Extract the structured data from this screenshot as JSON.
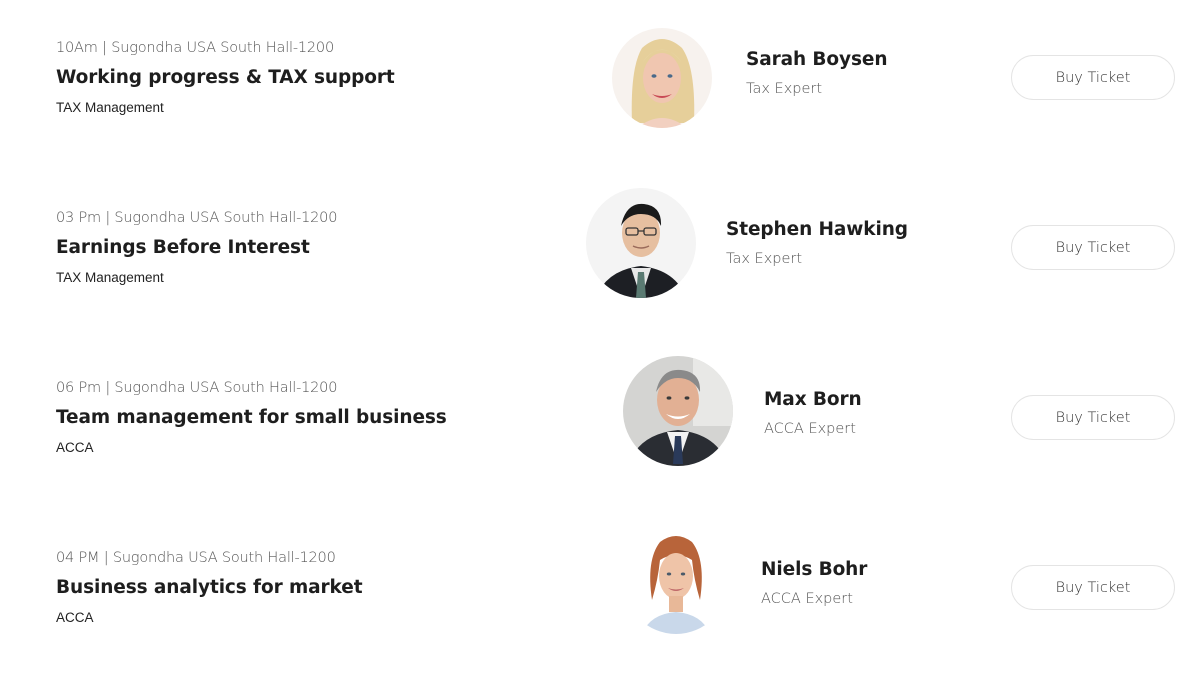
{
  "sessions": [
    {
      "meta": "10Am | Sugondha USA South Hall-1200",
      "title": "Working progress & TAX support",
      "category": "TAX Management",
      "speaker": {
        "name": "Sarah Boysen",
        "role": "Tax Expert"
      },
      "button_label": "Buy Ticket"
    },
    {
      "meta": "03 Pm | Sugondha USA South Hall-1200",
      "title": "Earnings Before Interest",
      "category": "TAX Management",
      "speaker": {
        "name": "Stephen Hawking",
        "role": "Tax Expert"
      },
      "button_label": "Buy Ticket"
    },
    {
      "meta": "06 Pm | Sugondha USA South Hall-1200",
      "title": "Team management for small business",
      "category": "ACCA",
      "speaker": {
        "name": "Max Born",
        "role": "ACCA Expert"
      },
      "button_label": "Buy Ticket"
    },
    {
      "meta": "04 PM | Sugondha USA South Hall-1200",
      "title": "Business analytics for market",
      "category": "ACCA",
      "speaker": {
        "name": "Niels Bohr",
        "role": "ACCA Expert"
      },
      "button_label": "Buy Ticket"
    }
  ],
  "colors": {
    "text": "#1e1e1e",
    "muted": "#555555",
    "button_border": "#e4e4e4"
  }
}
